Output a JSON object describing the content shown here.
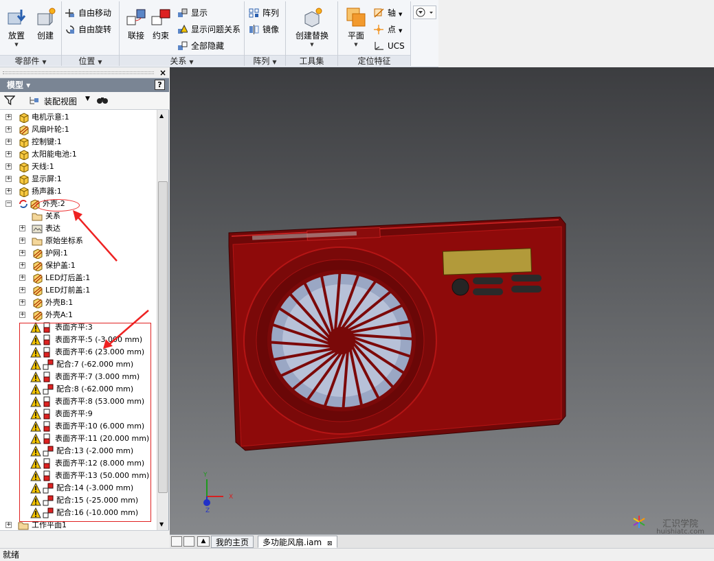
{
  "ribbon": {
    "panels": [
      {
        "title": "零部件",
        "dropdown": true
      },
      {
        "title": "位置",
        "dropdown": true
      },
      {
        "title": "关系",
        "dropdown": true
      },
      {
        "title": "阵列",
        "dropdown": true
      },
      {
        "title": "工具集",
        "dropdown": false
      },
      {
        "title": "定位特征",
        "dropdown": false
      }
    ],
    "place_label": "放置",
    "create_label": "创建",
    "free_move_label": "自由移动",
    "free_rotate_label": "自由旋转",
    "joint_label": "联接",
    "constrain_label": "约束",
    "show_label": "显示",
    "show_problem_label": "显示问题关系",
    "hide_all_label": "全部隐藏",
    "pattern_label": "阵列",
    "mirror_label": "镜像",
    "create_substitute_label": "创建替换",
    "plane_label": "平面",
    "axis_label": "轴",
    "point_label": "点",
    "ucs_label": "UCS"
  },
  "browser": {
    "header": "模型 ▾",
    "help_icon": "?",
    "close_icon": "×",
    "view_label": "装配视图",
    "components": [
      {
        "label": "电机示意:1"
      },
      {
        "label": "风扇叶轮:1"
      },
      {
        "label": "控制键:1"
      },
      {
        "label": "太阳能电池:1"
      },
      {
        "label": "天线:1"
      },
      {
        "label": "显示屏:1"
      },
      {
        "label": "扬声器:1"
      },
      {
        "label": "外壳:2"
      }
    ],
    "children": [
      {
        "label": "关系",
        "icon": "folder-icon",
        "expandable": false
      },
      {
        "label": "表达",
        "icon": "representation-icon",
        "expandable": true
      },
      {
        "label": "原始坐标系",
        "icon": "folder-icon",
        "expandable": true
      },
      {
        "label": "护网:1",
        "icon": "part-icon",
        "expandable": true
      },
      {
        "label": "保护盖:1",
        "icon": "part-icon",
        "expandable": true
      },
      {
        "label": "LED灯后盖:1",
        "icon": "part-icon",
        "expandable": true
      },
      {
        "label": "LED灯前盖:1",
        "icon": "part-icon",
        "expandable": true
      },
      {
        "label": "外壳B:1",
        "icon": "part-icon",
        "expandable": true
      },
      {
        "label": "外壳A:1",
        "icon": "part-icon",
        "expandable": true
      }
    ],
    "constraints": [
      {
        "label": "表面齐平:3",
        "type": "flush"
      },
      {
        "label": "表面齐平:5 (-3.000 mm)",
        "type": "flush"
      },
      {
        "label": "表面齐平:6 (23.000 mm)",
        "type": "flush"
      },
      {
        "label": "配合:7 (-62.000 mm)",
        "type": "mate"
      },
      {
        "label": "表面齐平:7 (3.000 mm)",
        "type": "flush"
      },
      {
        "label": "配合:8 (-62.000 mm)",
        "type": "mate"
      },
      {
        "label": "表面齐平:8 (53.000 mm)",
        "type": "flush"
      },
      {
        "label": "表面齐平:9",
        "type": "flush"
      },
      {
        "label": "表面齐平:10 (6.000 mm)",
        "type": "flush"
      },
      {
        "label": "表面齐平:11 (20.000 mm)",
        "type": "flush"
      },
      {
        "label": "配合:13 (-2.000 mm)",
        "type": "mate"
      },
      {
        "label": "表面齐平:12 (8.000 mm)",
        "type": "flush"
      },
      {
        "label": "表面齐平:13 (50.000 mm)",
        "type": "flush"
      },
      {
        "label": "配合:14 (-3.000 mm)",
        "type": "mate"
      },
      {
        "label": "配合:15 (-25.000 mm)",
        "type": "mate"
      },
      {
        "label": "配合:16 (-10.000 mm)",
        "type": "mate"
      }
    ],
    "work_plane": "工作平面1"
  },
  "viewport": {
    "axis_x": "X",
    "axis_y": "Y",
    "axis_z": "Z",
    "model_color": "#8e0a0a"
  },
  "tabs": [
    {
      "label": "我的主页"
    },
    {
      "label": "多功能风扇.iam"
    }
  ],
  "tab_close": "⊠",
  "watermark": {
    "cn": "汇识学院",
    "url": "huishiatc.com"
  },
  "status": "就绪"
}
